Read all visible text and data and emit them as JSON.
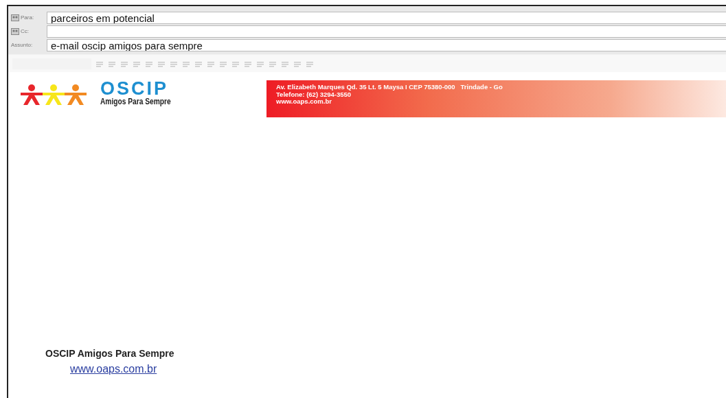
{
  "header_fields": [
    {
      "label": "Para:",
      "value": "parceiros em potencial",
      "kind": "address"
    },
    {
      "label": "Cc:",
      "kind": "address"
    },
    {
      "label": "Assunto:",
      "value": "e-mail oscip amigos para sempre",
      "kind": "subject"
    }
  ],
  "toolbar": {
    "disabled": true
  },
  "letterhead": {
    "logo_title": "OSCIP",
    "logo_subtitle": "Amigos Para Sempre",
    "address_lines": [
      "Av. Elizabeth Marques Qd. 35 Lt. 5 Maysa I CEP 75380-000   Trindade - Go",
      "Telefone: (62) 3294-3550",
      "www.oaps.com.br"
    ]
  },
  "signature": {
    "name": "OSCIP Amigos Para Sempre",
    "link": "www.oaps.com.br"
  }
}
